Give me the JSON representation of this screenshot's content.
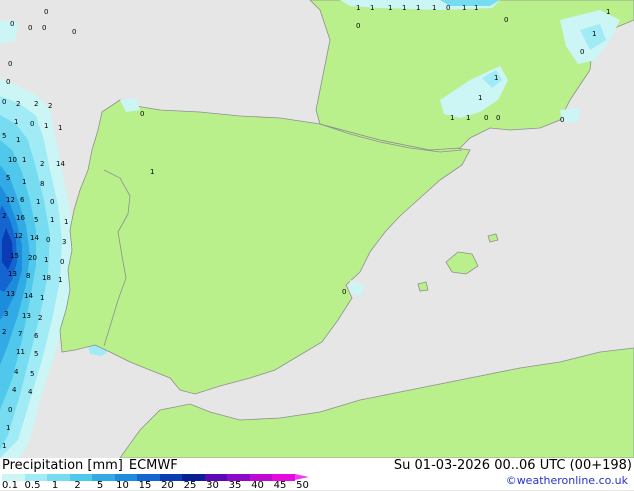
{
  "title": "Precipitation [mm]",
  "model": "ECMWF",
  "valid_time": "Su 01-03-2026 00..06 UTC (00+198)",
  "credit": "©weatheronline.co.uk",
  "colors": {
    "sea": "#e6e6e6",
    "land": "#b9f08c",
    "border": "#8f8f8f"
  },
  "legend": [
    {
      "label": "0.1",
      "color": "#ccf5f5"
    },
    {
      "label": "0.5",
      "color": "#a0ebf5"
    },
    {
      "label": "1",
      "color": "#78dcf0"
    },
    {
      "label": "2",
      "color": "#50c8eb"
    },
    {
      "label": "5",
      "color": "#32aae6"
    },
    {
      "label": "10",
      "color": "#1e8cdc"
    },
    {
      "label": "15",
      "color": "#1464d2"
    },
    {
      "label": "20",
      "color": "#0a3cb4"
    },
    {
      "label": "25",
      "color": "#0a1e96"
    },
    {
      "label": "30",
      "color": "#5a0ab4"
    },
    {
      "label": "35",
      "color": "#8c0ac8"
    },
    {
      "label": "40",
      "color": "#be0ad2"
    },
    {
      "label": "45",
      "color": "#e60ae1"
    },
    {
      "label": "50",
      "color": "#f03cf0"
    }
  ],
  "values": [
    "0",
    "0",
    "0",
    "0",
    "0",
    "0",
    "1",
    "1",
    "1",
    "1",
    "1",
    "1",
    "0",
    "1",
    "1",
    "0",
    "0",
    "1",
    "1",
    "0",
    "0",
    "0",
    "2",
    "2",
    "2",
    "1",
    "0",
    "1",
    "1",
    "5",
    "1",
    "10",
    "1",
    "2",
    "14",
    "5",
    "1",
    "8",
    "12",
    "6",
    "1",
    "0",
    "2",
    "16",
    "5",
    "1",
    "1",
    "12",
    "14",
    "0",
    "3",
    "15",
    "20",
    "1",
    "0",
    "13",
    "8",
    "18",
    "1",
    "13",
    "14",
    "1",
    "3",
    "13",
    "2",
    "2",
    "7",
    "6",
    "11",
    "5",
    "4",
    "5",
    "4",
    "4",
    "0",
    "1",
    "1",
    "1",
    "1",
    "1",
    "1",
    "0",
    "0",
    "0",
    "1",
    "0",
    "0"
  ]
}
